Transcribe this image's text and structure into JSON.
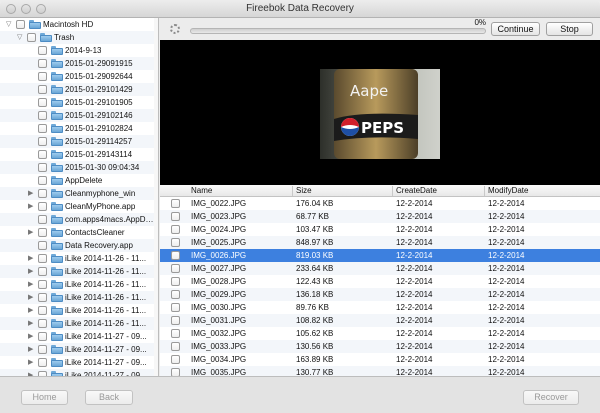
{
  "window": {
    "title": "Fireebok Data Recovery"
  },
  "tree": [
    {
      "label": "Macintosh HD",
      "expanded": true,
      "depth": 0,
      "has_children": true
    },
    {
      "label": "Trash",
      "expanded": true,
      "depth": 1,
      "has_children": true
    },
    {
      "label": "2014-9-13",
      "depth": 2,
      "has_children": false
    },
    {
      "label": "2015-01-29091915",
      "depth": 2,
      "has_children": false
    },
    {
      "label": "2015-01-29092644",
      "depth": 2,
      "has_children": false
    },
    {
      "label": "2015-01-29101429",
      "depth": 2,
      "has_children": false
    },
    {
      "label": "2015-01-29101905",
      "depth": 2,
      "has_children": false
    },
    {
      "label": "2015-01-29102146",
      "depth": 2,
      "has_children": false
    },
    {
      "label": "2015-01-29102824",
      "depth": 2,
      "has_children": false
    },
    {
      "label": "2015-01-29114257",
      "depth": 2,
      "has_children": false
    },
    {
      "label": "2015-01-29143114",
      "depth": 2,
      "has_children": false
    },
    {
      "label": "2015-01-30 09:04:34",
      "depth": 2,
      "has_children": false
    },
    {
      "label": "AppDelete",
      "depth": 2,
      "has_children": false
    },
    {
      "label": "Cleanmyphone_win",
      "depth": 2,
      "has_children": true
    },
    {
      "label": "CleanMyPhone.app",
      "depth": 2,
      "has_children": true
    },
    {
      "label": "com.apps4macs.AppDelete",
      "depth": 2,
      "has_children": false
    },
    {
      "label": "ContactsCleaner",
      "depth": 2,
      "has_children": true
    },
    {
      "label": "Data Recovery.app",
      "depth": 2,
      "has_children": false
    },
    {
      "label": "iLike 2014-11-26 - 11...",
      "depth": 2,
      "has_children": true
    },
    {
      "label": "iLike 2014-11-26 - 11...",
      "depth": 2,
      "has_children": true
    },
    {
      "label": "iLike 2014-11-26 - 11...",
      "depth": 2,
      "has_children": true
    },
    {
      "label": "iLike 2014-11-26 - 11...",
      "depth": 2,
      "has_children": true
    },
    {
      "label": "iLike 2014-11-26 - 11...",
      "depth": 2,
      "has_children": true
    },
    {
      "label": "iLike 2014-11-26 - 11...",
      "depth": 2,
      "has_children": true
    },
    {
      "label": "iLike 2014-11-27 - 09...",
      "depth": 2,
      "has_children": true
    },
    {
      "label": "iLike 2014-11-27 - 09...",
      "depth": 2,
      "has_children": true
    },
    {
      "label": "iLike 2014-11-27 - 09...",
      "depth": 2,
      "has_children": true
    },
    {
      "label": "iLike 2014-11-27 - 09...",
      "depth": 2,
      "has_children": true
    },
    {
      "label": "iLike 2014-11-27 - 09...",
      "depth": 2,
      "has_children": true
    }
  ],
  "progress": {
    "percent_label": "0%",
    "value": 0
  },
  "buttons": {
    "continue": "Continue",
    "stop": "Stop",
    "home": "Home",
    "back": "Back",
    "recover": "Recover"
  },
  "preview": {
    "brand_text": "Aape",
    "logo_text": "PEPS"
  },
  "table": {
    "columns": [
      "Name",
      "Size",
      "CreateDate",
      "ModifyDate"
    ],
    "rows": [
      {
        "name": "IMG_0022.JPG",
        "size": "176.04 KB",
        "create": "12-2-2014",
        "modify": "12-2-2014"
      },
      {
        "name": "IMG_0023.JPG",
        "size": "68.77 KB",
        "create": "12-2-2014",
        "modify": "12-2-2014"
      },
      {
        "name": "IMG_0024.JPG",
        "size": "103.47 KB",
        "create": "12-2-2014",
        "modify": "12-2-2014"
      },
      {
        "name": "IMG_0025.JPG",
        "size": "848.97 KB",
        "create": "12-2-2014",
        "modify": "12-2-2014"
      },
      {
        "name": "IMG_0026.JPG",
        "size": "819.03 KB",
        "create": "12-2-2014",
        "modify": "12-2-2014",
        "selected": true
      },
      {
        "name": "IMG_0027.JPG",
        "size": "233.64 KB",
        "create": "12-2-2014",
        "modify": "12-2-2014"
      },
      {
        "name": "IMG_0028.JPG",
        "size": "122.43 KB",
        "create": "12-2-2014",
        "modify": "12-2-2014"
      },
      {
        "name": "IMG_0029.JPG",
        "size": "136.18 KB",
        "create": "12-2-2014",
        "modify": "12-2-2014"
      },
      {
        "name": "IMG_0030.JPG",
        "size": "89.76 KB",
        "create": "12-2-2014",
        "modify": "12-2-2014"
      },
      {
        "name": "IMG_0031.JPG",
        "size": "108.82 KB",
        "create": "12-2-2014",
        "modify": "12-2-2014"
      },
      {
        "name": "IMG_0032.JPG",
        "size": "105.62 KB",
        "create": "12-2-2014",
        "modify": "12-2-2014"
      },
      {
        "name": "IMG_0033.JPG",
        "size": "130.56 KB",
        "create": "12-2-2014",
        "modify": "12-2-2014"
      },
      {
        "name": "IMG_0034.JPG",
        "size": "163.89 KB",
        "create": "12-2-2014",
        "modify": "12-2-2014"
      },
      {
        "name": "IMG_0035.JPG",
        "size": "130.77 KB",
        "create": "12-2-2014",
        "modify": "12-2-2014"
      }
    ]
  },
  "colors": {
    "selection": "#3d80df",
    "progress": "#5c9be0",
    "folder": "#6aa6d6"
  }
}
